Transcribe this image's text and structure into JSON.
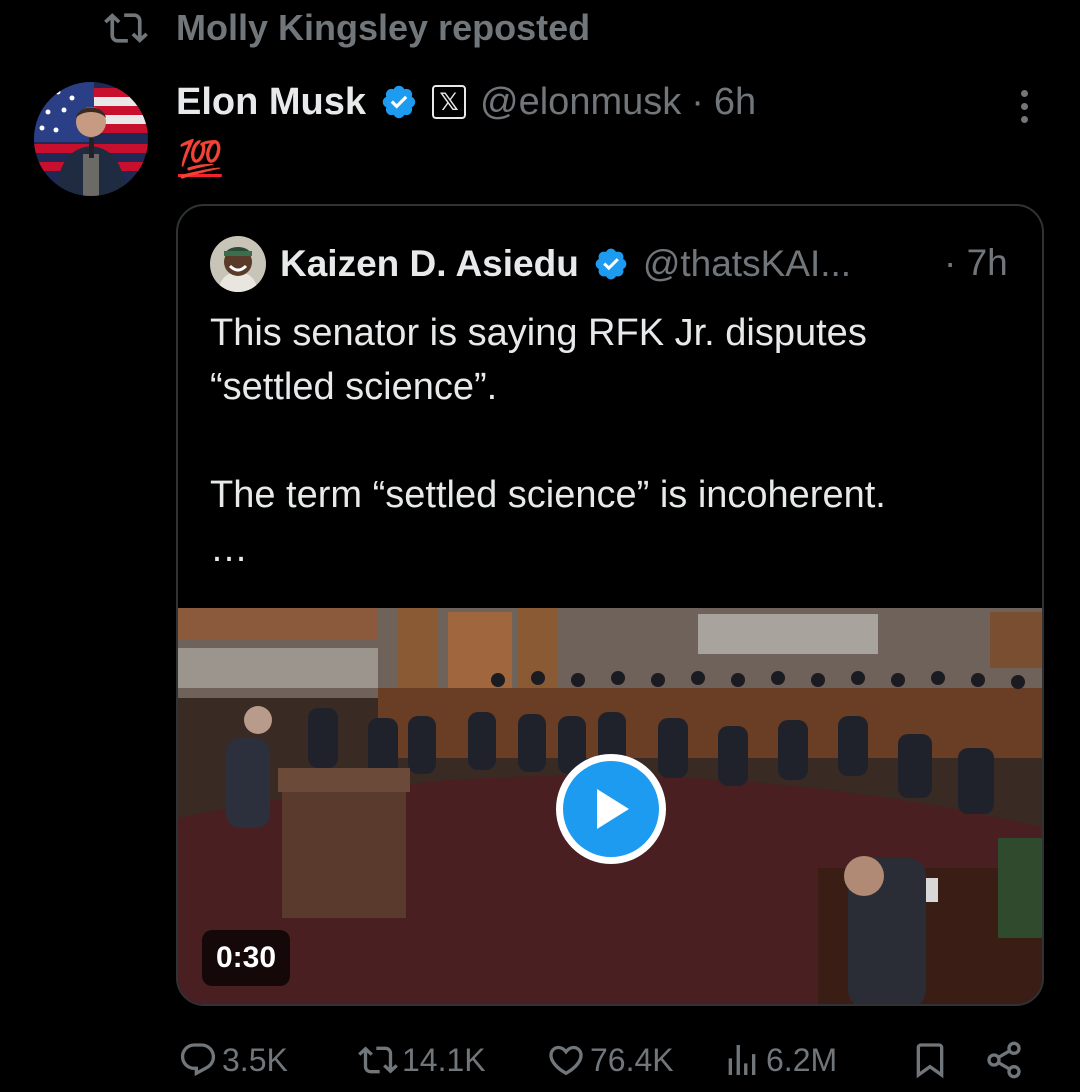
{
  "repost": {
    "label": "Molly Kingsley reposted",
    "icon": "repost-icon"
  },
  "tweet": {
    "author_name": "Elon Musk",
    "handle": "@elonmusk",
    "separator": "·",
    "time": "6h",
    "text": "💯",
    "verified_color": "#1d9bf0",
    "affiliation_badge": "𝕏"
  },
  "quote": {
    "author_name": "Kaizen D. Asiedu",
    "handle": "@thatsKAI...",
    "time": "· 7h",
    "text": "This senator is saying RFK Jr. disputes\n“settled science”.\n\nThe term “settled science” is incoherent.\n…",
    "video_duration": "0:30"
  },
  "actions": {
    "replies": "3.5K",
    "reposts": "14.1K",
    "likes": "76.4K",
    "views": "6.2M"
  },
  "colors": {
    "accent": "#1d9bf0",
    "muted": "#71767b",
    "text": "#e7e9ea",
    "background": "#000000"
  }
}
